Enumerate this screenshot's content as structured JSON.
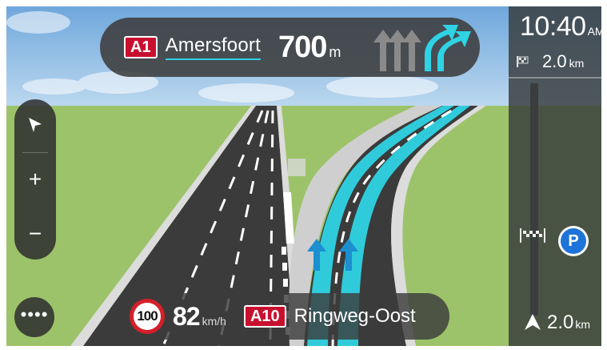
{
  "instruction": {
    "road_number": "A1",
    "street": "Amersfoort",
    "distance_value": "700",
    "distance_unit": "m"
  },
  "side_panel": {
    "time": "10:40",
    "am_pm": "AM",
    "destination_distance": "2.0",
    "destination_unit": "km",
    "bottom_distance": "2.0",
    "bottom_unit": "km",
    "poi_parking_label": "P"
  },
  "map_controls": {
    "zoom_in_label": "+",
    "zoom_out_label": "−",
    "main_menu_label": "••••"
  },
  "status_bar": {
    "speed_limit": "100",
    "current_speed": "82",
    "speed_unit": "km/h",
    "road_number": "A10",
    "road_name": "Ringweg-Oost"
  },
  "colors": {
    "guidance_cyan": "#2fd3e4",
    "road_badge_red": "#c8102e",
    "speed_limit_ring": "#d51f2a",
    "parking_blue": "#1e73d8",
    "grass": "#9cc36a",
    "asphalt": "#3b3b3b"
  },
  "icons": {
    "lane_guidance": "lane-arrows-icon",
    "navigation_mode": "arrow-cursor-icon",
    "destination": "checkered-flag-icon",
    "current_position": "navigation-chevron-icon",
    "parking": "parking-icon"
  }
}
